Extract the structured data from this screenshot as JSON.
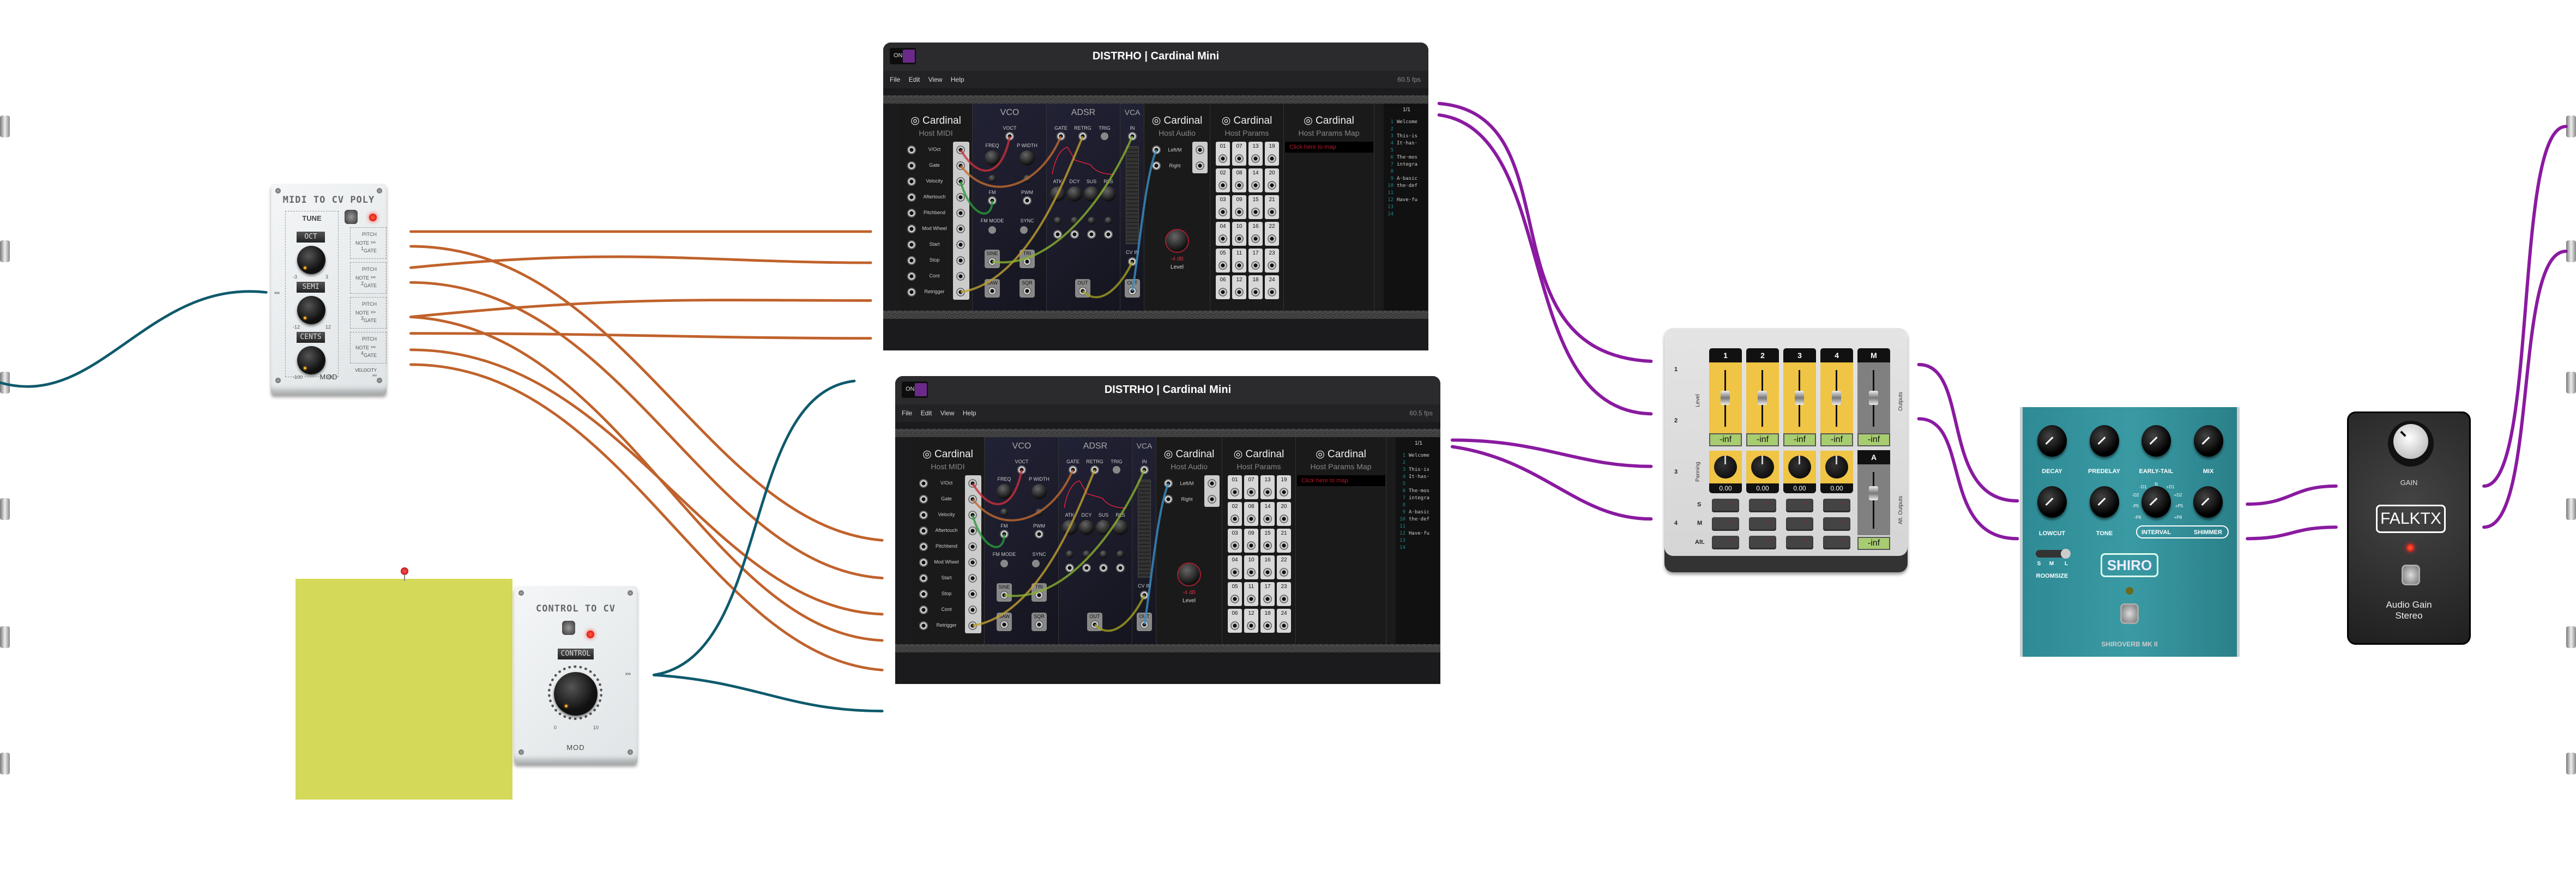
{
  "midi_to_cv": {
    "title": "MIDI TO CV POLY",
    "tune_label": "TUNE",
    "knobs": [
      {
        "label": "OCT",
        "min": "-3",
        "max": "3"
      },
      {
        "label": "SEMI",
        "min": "-12",
        "max": "12"
      },
      {
        "label": "CENTS",
        "min": "-100",
        "max": "100"
      }
    ],
    "notes": [
      {
        "label": "NOTE",
        "num": "1",
        "pitch": "PITCH",
        "gate": "GATE",
        "arrow": "›››"
      },
      {
        "label": "NOTE",
        "num": "2",
        "pitch": "PITCH",
        "gate": "GATE",
        "arrow": "›››"
      },
      {
        "label": "NOTE",
        "num": "3",
        "pitch": "PITCH",
        "gate": "GATE",
        "arrow": "›››"
      },
      {
        "label": "NOTE",
        "num": "4",
        "pitch": "PITCH",
        "gate": "GATE",
        "arrow": "›››"
      }
    ],
    "velocity": "VELOCITY",
    "input_arrow": "›››",
    "brand": "MOD"
  },
  "control_to_cv": {
    "title": "CONTROL TO CV",
    "knob_label": "CONTROL",
    "min": "0",
    "max": "10",
    "out_arrow": "›››",
    "brand": "MOD"
  },
  "cardinals": [
    {
      "power": "ON",
      "title": "DISTRHO | Cardinal Mini",
      "menu": [
        "File",
        "Edit",
        "View",
        "Help"
      ],
      "fps": "60.5 fps",
      "brand": "Cardinal",
      "host_midi": {
        "subtitle": "Host MIDI",
        "rows": [
          "V/Oct",
          "Gate",
          "Velocity",
          "Aftertouch",
          "Pitchbend",
          "Mod Wheel",
          "Start",
          "Stop",
          "Cont",
          "Retrigger"
        ]
      },
      "vco": {
        "title": "VCO",
        "voct": "VOCT",
        "freq": "FREQ",
        "pwidth": "P WIDTH",
        "fm": "FM",
        "pwm": "PWM",
        "fm_mode": "FM MODE",
        "sync": "SYNC",
        "sine": "SINE",
        "tri": "TRI",
        "saw": "SAW",
        "sqr": "SQR"
      },
      "adsr": {
        "title": "ADSR",
        "gate": "GATE",
        "retrg": "RETRG",
        "trig": "TRIG",
        "atk": "ATK",
        "dcy": "DCY",
        "sus": "SUS",
        "rls": "RLS",
        "out": "OUT"
      },
      "vca": {
        "title": "VCA",
        "in": "IN",
        "cv_in": "CV IN",
        "out": "OUT"
      },
      "host_audio": {
        "subtitle": "Host Audio",
        "left": "Left/M",
        "right": "Right",
        "level_value": "-4 dB",
        "level_label": "Level"
      },
      "host_params": {
        "subtitle": "Host Params",
        "cells": [
          "01",
          "07",
          "13",
          "19",
          "02",
          "08",
          "14",
          "20",
          "03",
          "09",
          "15",
          "21",
          "04",
          "10",
          "16",
          "22",
          "05",
          "11",
          "17",
          "23",
          "06",
          "12",
          "18",
          "24"
        ]
      },
      "host_params_map": {
        "subtitle": "Host Params Map",
        "button": "Click here to map"
      },
      "editor": {
        "page": "1/1",
        "lines": [
          "Welcome",
          "",
          "This·is",
          "It·has·",
          "",
          "The·mos",
          "integra",
          "",
          "A·basic",
          "the·def",
          "",
          "Have·fu",
          "",
          ""
        ]
      }
    },
    {
      "power": "ON",
      "title": "DISTRHO | Cardinal Mini",
      "menu": [
        "File",
        "Edit",
        "View",
        "Help"
      ],
      "fps": "60.5 fps",
      "brand": "Cardinal",
      "host_midi": {
        "subtitle": "Host MIDI",
        "rows": [
          "V/Oct",
          "Gate",
          "Velocity",
          "Aftertouch",
          "Pitchbend",
          "Mod Wheel",
          "Start",
          "Stop",
          "Cont",
          "Retrigger"
        ]
      },
      "vco": {
        "title": "VCO",
        "voct": "VOCT",
        "freq": "FREQ",
        "pwidth": "P WIDTH",
        "fm": "FM",
        "pwm": "PWM",
        "fm_mode": "FM MODE",
        "sync": "SYNC",
        "sine": "SINE",
        "tri": "TRI",
        "saw": "SAW",
        "sqr": "SQR"
      },
      "adsr": {
        "title": "ADSR",
        "gate": "GATE",
        "retrg": "RETRG",
        "trig": "TRIG",
        "atk": "ATK",
        "dcy": "DCY",
        "sus": "SUS",
        "rls": "RLS",
        "out": "OUT"
      },
      "vca": {
        "title": "VCA",
        "in": "IN",
        "cv_in": "CV IN",
        "out": "OUT"
      },
      "host_audio": {
        "subtitle": "Host Audio",
        "left": "Left/M",
        "right": "Right",
        "level_value": "-4 dB",
        "level_label": "Level"
      },
      "host_params": {
        "subtitle": "Host Params",
        "cells": [
          "01",
          "07",
          "13",
          "19",
          "02",
          "08",
          "14",
          "20",
          "03",
          "09",
          "15",
          "21",
          "04",
          "10",
          "16",
          "22",
          "05",
          "11",
          "17",
          "23",
          "06",
          "12",
          "18",
          "24"
        ]
      },
      "host_params_map": {
        "subtitle": "Host Params Map",
        "button": "Click here to map"
      },
      "editor": {
        "page": "1/1",
        "lines": [
          "Welcome",
          "",
          "This·is",
          "It·has·",
          "",
          "The·mos",
          "integra",
          "",
          "A·basic",
          "the·def",
          "",
          "Have·fu",
          "",
          ""
        ]
      }
    }
  ],
  "mixer": {
    "inputs": [
      "1",
      "2",
      "3",
      "4"
    ],
    "level_label": "Level",
    "panning_label": "Panning",
    "outputs_label": "Outputs",
    "alt_outputs_label": "Alt. Outputs",
    "channels": [
      {
        "name": "1",
        "level": "-inf",
        "pan": "0.00"
      },
      {
        "name": "2",
        "level": "-inf",
        "pan": "0.00"
      },
      {
        "name": "3",
        "level": "-inf",
        "pan": "0.00"
      },
      {
        "name": "4",
        "level": "-inf",
        "pan": "0.00"
      }
    ],
    "master": {
      "name": "M",
      "level": "-inf"
    },
    "alt": {
      "name": "A",
      "level": "-inf"
    },
    "rows": [
      "S",
      "M",
      "Alt."
    ]
  },
  "shiroverb": {
    "knobs_row1": [
      "DECAY",
      "PREDELAY",
      "EARLY-TAIL",
      "MIX"
    ],
    "knobs_row2": [
      "LOWCUT",
      "TONE"
    ],
    "interval": "INTERVAL",
    "shimmer": "SHIMMER",
    "interval_marks": [
      "-D1",
      "N",
      "+D1",
      "-D2",
      "+D2",
      "-P5",
      "+P5",
      "-P8",
      "+P8"
    ],
    "roomsize_options": [
      "S",
      "M",
      "L"
    ],
    "roomsize_label": "ROOMSIZE",
    "logo": "SHIRO",
    "name": "SHIROVERB MK II",
    "accent": "#2e8a94"
  },
  "falktx": {
    "gain_label": "GAIN",
    "logo": "FALKTX",
    "name_line1": "Audio Gain",
    "name_line2": "Stereo"
  },
  "colors": {
    "cable_cv": "#c0622c",
    "cable_midi": "#0f5a6c",
    "cable_audio": "#8a1aa0",
    "sticky_note": "#d4d95a"
  }
}
